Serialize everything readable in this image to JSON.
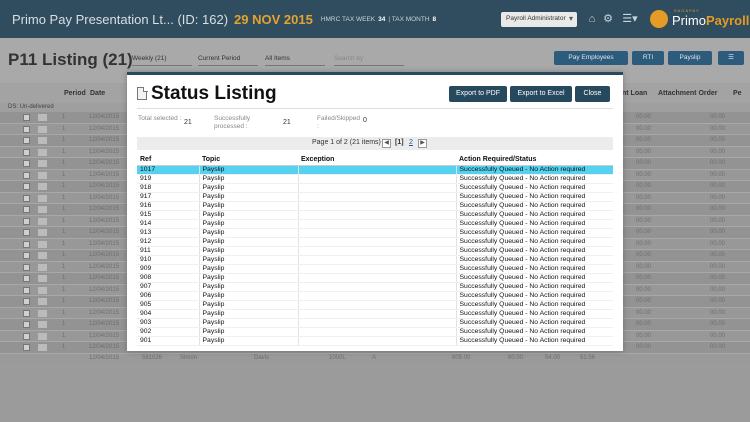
{
  "app": {
    "title": "Primo Pay Presentation Lt... (ID: 162)",
    "date": "29 NOV 2015",
    "tax_week_label": "HMRC TAX WEEK",
    "tax_week": "34",
    "tax_month_label": "TAX MONTH",
    "tax_month": "8",
    "user_role": "Payroll Administrator",
    "logo_tag": "SAGAPAY",
    "logo_primo": "Primo",
    "logo_payroll": "Payroll"
  },
  "subbar": {
    "title": "P11 Listing (21)",
    "period_type": "Weekly (21)",
    "period": "Current Period",
    "filter": "All Items",
    "search_placeholder": "Search by",
    "pay_employees": "Pay Employees",
    "rti": "RTI",
    "payslip": "Payslip"
  },
  "grid": {
    "headers": [
      "Period",
      "Date",
      "nt Loan",
      "Attachment Order",
      "Pe"
    ],
    "group_label": "DS: Un-delivered",
    "row_period": "1",
    "row_date": "12/04/2015",
    "row_value": "00.00",
    "footer_row": [
      "12/04/2015",
      "581026",
      "Simon",
      "Davis",
      "1000L",
      "A",
      "805.00",
      "80.00",
      "54.00",
      "51.56"
    ]
  },
  "modal": {
    "title": "Status Listing",
    "export_pdf": "Export to PDF",
    "export_excel": "Export to Excel",
    "close": "Close",
    "total_selected_label": "Total selected :",
    "total_selected": "21",
    "processed_label": "Successfully processed :",
    "processed": "21",
    "failed_label": "Failed/Skipped :",
    "failed": "0",
    "pager_text": "Page 1 of 2 (21 items)",
    "page_current": "[1]",
    "page_next": "2",
    "columns": [
      "Ref",
      "Topic",
      "Exception",
      "Action Required/Status"
    ],
    "rows": [
      {
        "ref": "1017",
        "topic": "Payslip",
        "exception": "",
        "status": "Successfully Queued - No Action required"
      },
      {
        "ref": "919",
        "topic": "Payslip",
        "exception": "",
        "status": "Successfully Queued - No Action required"
      },
      {
        "ref": "918",
        "topic": "Payslip",
        "exception": "",
        "status": "Successfully Queued - No Action required"
      },
      {
        "ref": "917",
        "topic": "Payslip",
        "exception": "",
        "status": "Successfully Queued - No Action required"
      },
      {
        "ref": "916",
        "topic": "Payslip",
        "exception": "",
        "status": "Successfully Queued - No Action required"
      },
      {
        "ref": "915",
        "topic": "Payslip",
        "exception": "",
        "status": "Successfully Queued - No Action required"
      },
      {
        "ref": "914",
        "topic": "Payslip",
        "exception": "",
        "status": "Successfully Queued - No Action required"
      },
      {
        "ref": "913",
        "topic": "Payslip",
        "exception": "",
        "status": "Successfully Queued - No Action required"
      },
      {
        "ref": "912",
        "topic": "Payslip",
        "exception": "",
        "status": "Successfully Queued - No Action required"
      },
      {
        "ref": "911",
        "topic": "Payslip",
        "exception": "",
        "status": "Successfully Queued - No Action required"
      },
      {
        "ref": "910",
        "topic": "Payslip",
        "exception": "",
        "status": "Successfully Queued - No Action required"
      },
      {
        "ref": "909",
        "topic": "Payslip",
        "exception": "",
        "status": "Successfully Queued - No Action required"
      },
      {
        "ref": "908",
        "topic": "Payslip",
        "exception": "",
        "status": "Successfully Queued - No Action required"
      },
      {
        "ref": "907",
        "topic": "Payslip",
        "exception": "",
        "status": "Successfully Queued - No Action required"
      },
      {
        "ref": "906",
        "topic": "Payslip",
        "exception": "",
        "status": "Successfully Queued - No Action required"
      },
      {
        "ref": "905",
        "topic": "Payslip",
        "exception": "",
        "status": "Successfully Queued - No Action required"
      },
      {
        "ref": "904",
        "topic": "Payslip",
        "exception": "",
        "status": "Successfully Queued - No Action required"
      },
      {
        "ref": "903",
        "topic": "Payslip",
        "exception": "",
        "status": "Successfully Queued - No Action required"
      },
      {
        "ref": "902",
        "topic": "Payslip",
        "exception": "",
        "status": "Successfully Queued - No Action required"
      },
      {
        "ref": "901",
        "topic": "Payslip",
        "exception": "",
        "status": "Successfully Queued - No Action required"
      }
    ]
  },
  "colors": {
    "header_bg": "#2f4d5f",
    "accent": "#e59b25",
    "button": "#27495e",
    "selected_row": "#54d2f0"
  }
}
